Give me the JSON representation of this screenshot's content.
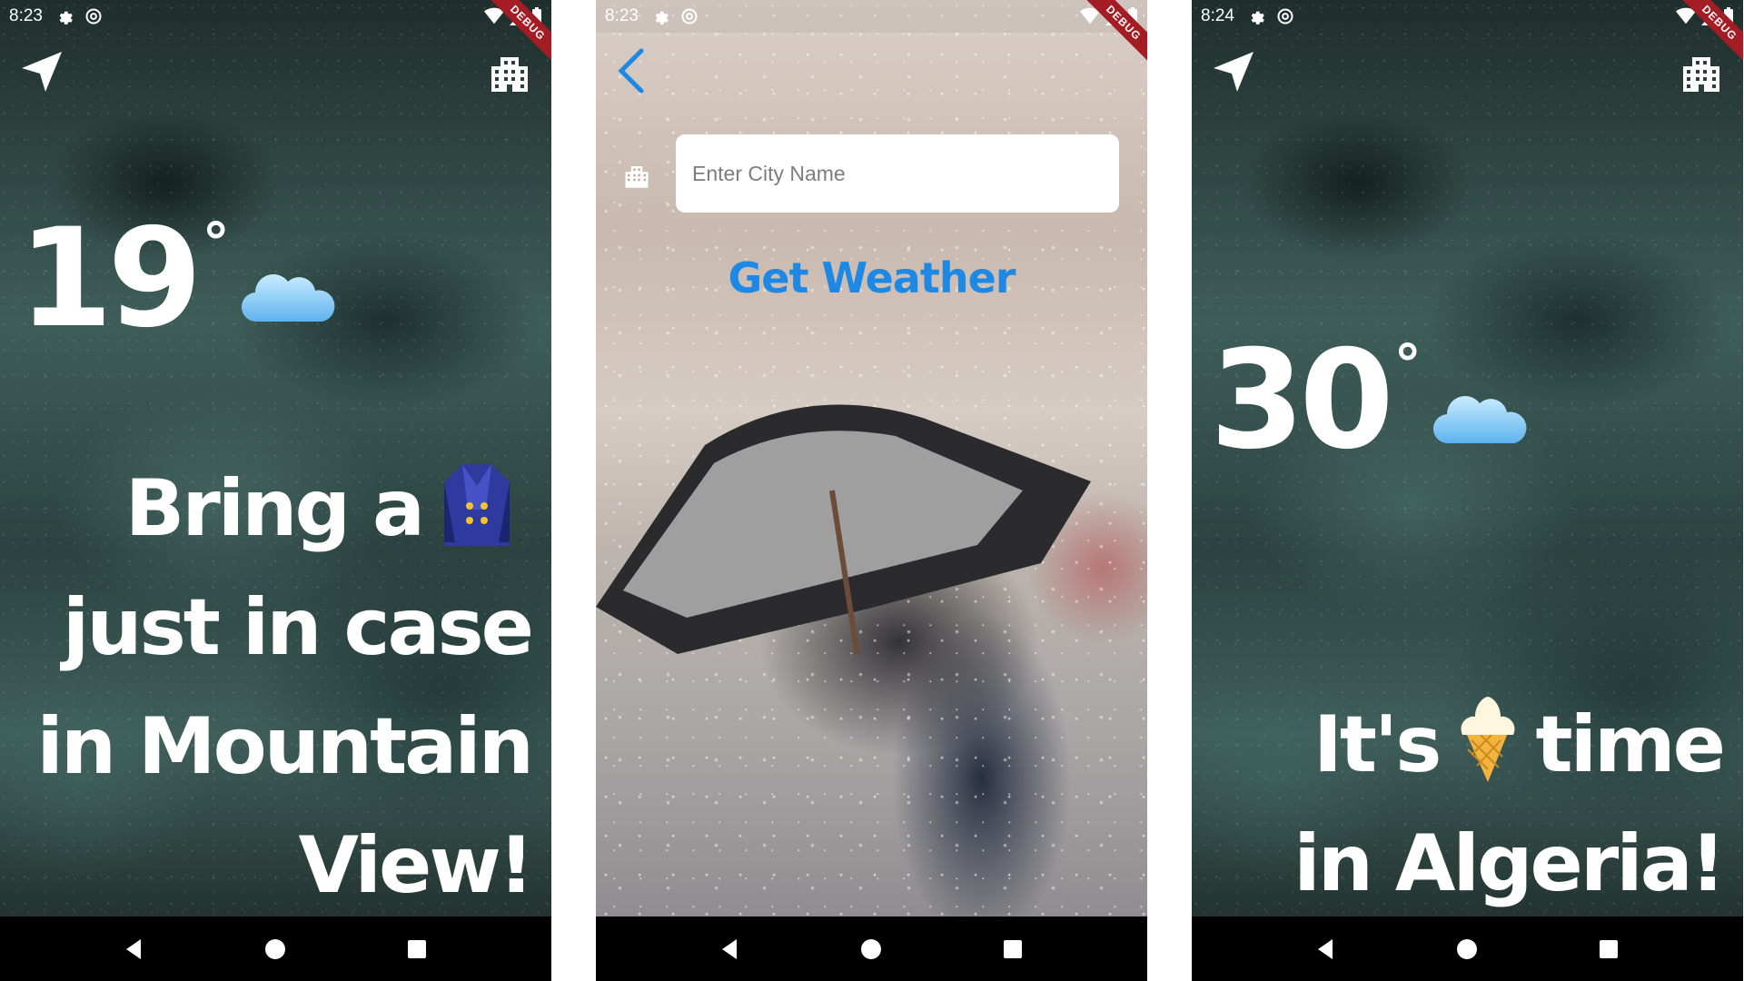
{
  "screens": [
    {
      "status": {
        "time": "8:23",
        "debug": "DEBUG"
      },
      "temperature": "19",
      "degree": "°",
      "weather_icon": "cloud-icon",
      "message": {
        "line1_a": "Bring a",
        "line1_icon": "coat-icon",
        "line2": "just in case",
        "line3": "in Mountain",
        "line4": "View!"
      }
    },
    {
      "status": {
        "time": "8:23",
        "debug": "DEBUG"
      },
      "search": {
        "placeholder": "Enter City Name",
        "value": ""
      },
      "button_label": "Get Weather",
      "accent": "#1E88E5"
    },
    {
      "status": {
        "time": "8:24",
        "debug": "DEBUG"
      },
      "temperature": "30",
      "degree": "°",
      "weather_icon": "cloud-icon",
      "message": {
        "line1_a": "It's",
        "line1_icon": "ice-cream-icon",
        "line1_b": "time",
        "line2": "in Algeria!"
      }
    }
  ],
  "icons": {
    "location": "location-arrow-icon",
    "city": "city-icon",
    "back": "back-chevron-icon"
  }
}
